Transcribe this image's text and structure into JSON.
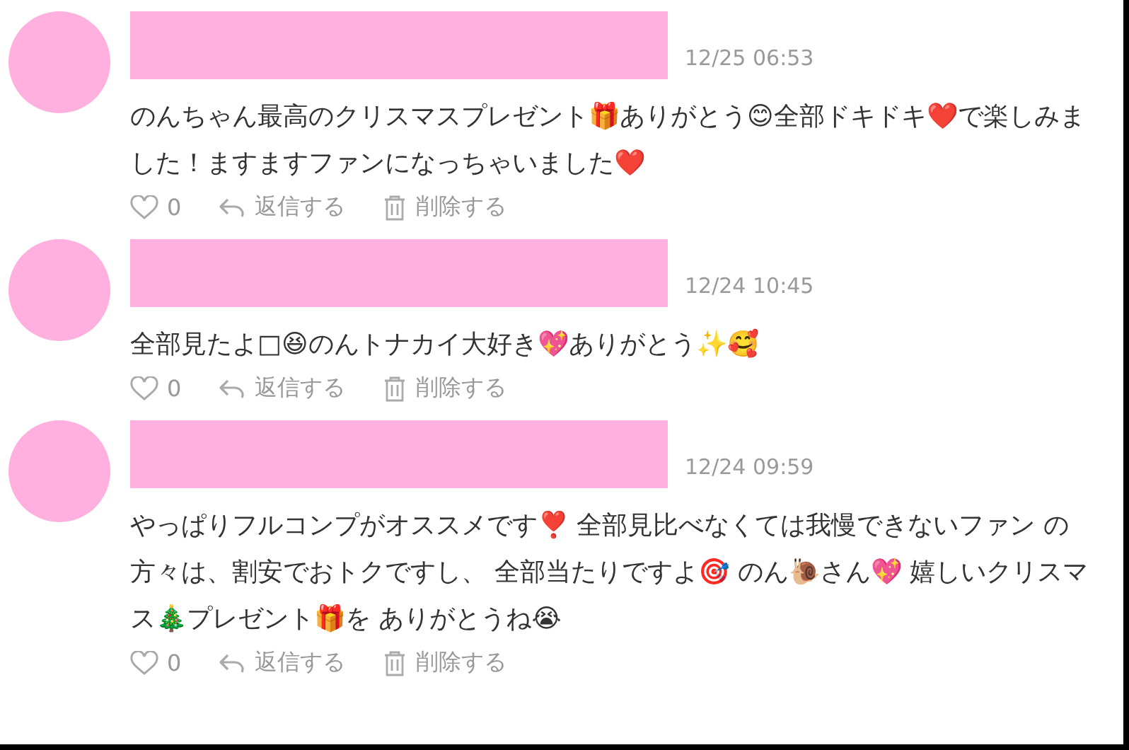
{
  "comments": [
    {
      "date": "12/25 06:53",
      "text": "のんちゃん最高のクリスマスプレゼント🎁ありがとう😊全部ドキドキ❤️で楽しみました！ますますファンになっちゃいました❤️",
      "likes": "0",
      "reply": "返信する",
      "delete": "削除する"
    },
    {
      "date": "12/24 10:45",
      "text": "全部見たよ□😆のんトナカイ大好き💖ありがとう✨🥰",
      "likes": "0",
      "reply": "返信する",
      "delete": "削除する"
    },
    {
      "date": "12/24 09:59",
      "text": "やっぱりフルコンプがオススメです❣️ 全部見比べなくては我慢できないファン の方々は、割安でおトクですし、 全部当たりですよ🎯 のん🐌さん💖 嬉しいクリスマス🎄プレゼント🎁を ありがとうね😭",
      "likes": "0",
      "reply": "返信する",
      "delete": "削除する"
    }
  ]
}
